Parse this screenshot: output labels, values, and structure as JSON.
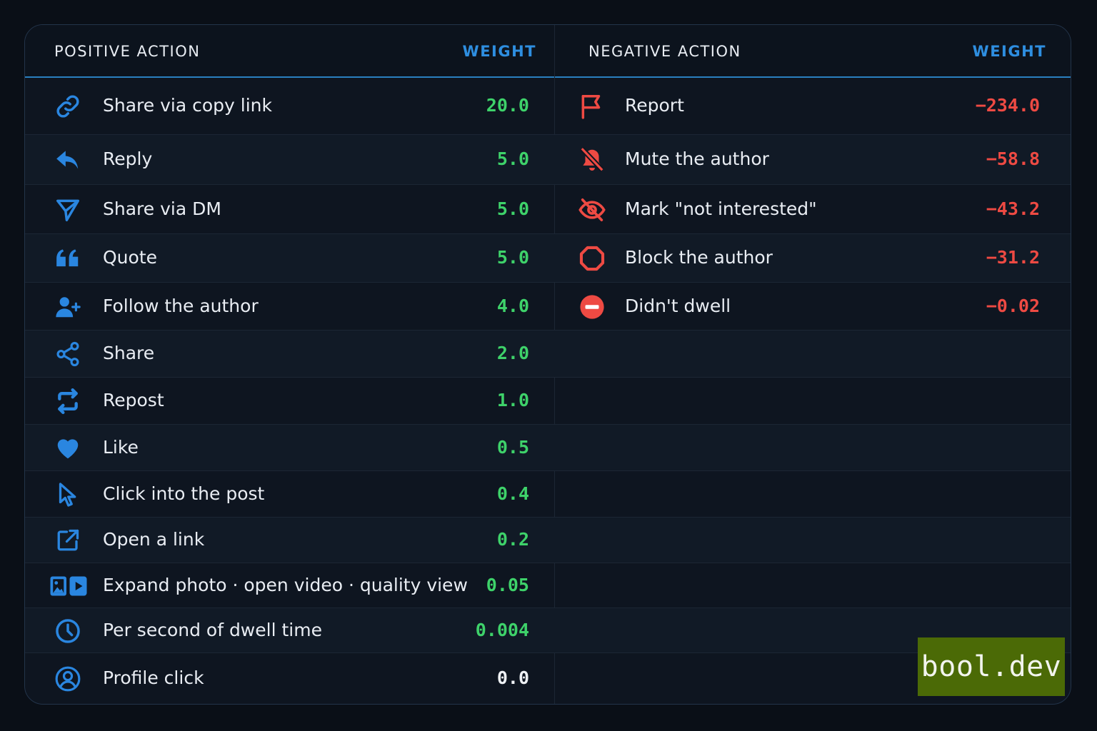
{
  "header": {
    "positive_label": "POSITIVE ACTION",
    "positive_weight": "WEIGHT",
    "negative_label": "NEGATIVE ACTION",
    "negative_weight": "WEIGHT"
  },
  "positive": [
    {
      "label": "Share via copy link",
      "value": "20.0",
      "icon": "link-icon"
    },
    {
      "label": "Reply",
      "value": "5.0",
      "icon": "reply-icon"
    },
    {
      "label": "Share via DM",
      "value": "5.0",
      "icon": "send-icon"
    },
    {
      "label": "Quote",
      "value": "5.0",
      "icon": "quote-icon"
    },
    {
      "label": "Follow the author",
      "value": "4.0",
      "icon": "user-plus-icon"
    },
    {
      "label": "Share",
      "value": "2.0",
      "icon": "share-icon"
    },
    {
      "label": "Repost",
      "value": "1.0",
      "icon": "repost-icon"
    },
    {
      "label": "Like",
      "value": "0.5",
      "icon": "heart-icon"
    },
    {
      "label": "Click into the post",
      "value": "0.4",
      "icon": "cursor-icon"
    },
    {
      "label": "Open a link",
      "value": "0.2",
      "icon": "external-link-icon"
    },
    {
      "label": "Expand photo · open video · quality view",
      "value": "0.05",
      "icon": "photo-video-icon"
    },
    {
      "label": "Per second of dwell time",
      "value": "0.004",
      "icon": "clock-icon"
    },
    {
      "label": "Profile click",
      "value": "0.0",
      "icon": "profile-icon"
    }
  ],
  "negative": [
    {
      "label": "Report",
      "value": "−234.0",
      "icon": "flag-icon"
    },
    {
      "label": "Mute the author",
      "value": "−58.8",
      "icon": "bell-off-icon"
    },
    {
      "label": "Mark \"not interested\"",
      "value": "−43.2",
      "icon": "eye-off-icon"
    },
    {
      "label": "Block the author",
      "value": "−31.2",
      "icon": "octagon-icon"
    },
    {
      "label": "Didn't dwell",
      "value": "−0.02",
      "icon": "minus-circle-icon"
    }
  ],
  "colors": {
    "positive": "#3ed26a",
    "negative": "#ee4a43",
    "accent": "#2e8ee0",
    "icon_blue": "#2a86e0",
    "icon_red": "#ee4a43"
  },
  "watermark": "bool.dev"
}
